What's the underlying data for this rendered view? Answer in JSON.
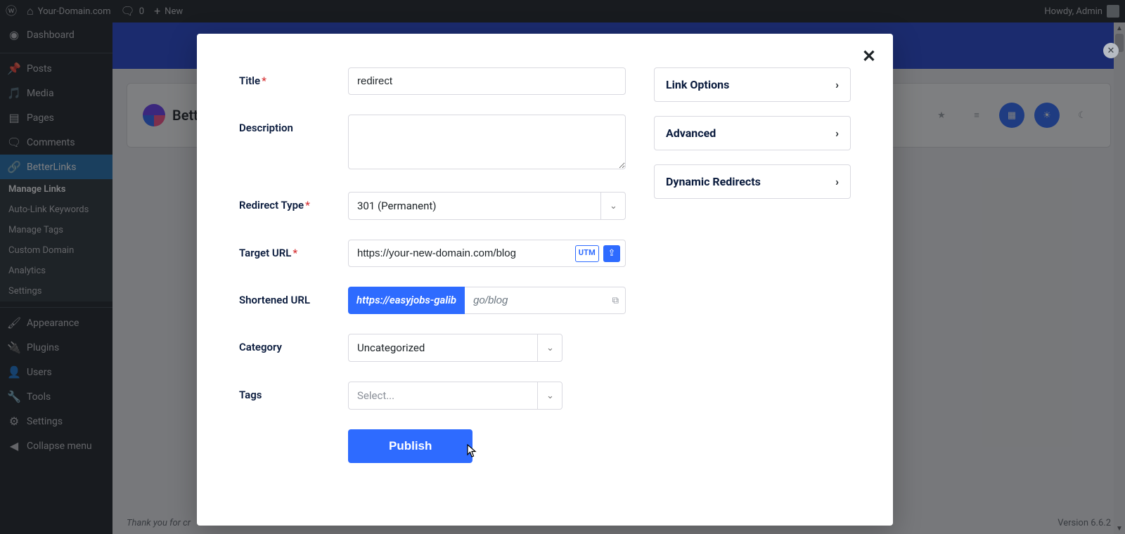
{
  "adminbar": {
    "site_name": "Your-Domain.com",
    "comments_count": "0",
    "new_label": "New",
    "greeting": "Howdy, Admin"
  },
  "sidebar": {
    "dashboard": "Dashboard",
    "posts": "Posts",
    "media": "Media",
    "pages": "Pages",
    "comments": "Comments",
    "betterlinks": "BetterLinks",
    "submenu": {
      "manage_links": "Manage Links",
      "auto_link": "Auto-Link Keywords",
      "manage_tags": "Manage Tags",
      "custom_domain": "Custom Domain",
      "analytics": "Analytics",
      "settings": "Settings"
    },
    "appearance": "Appearance",
    "plugins": "Plugins",
    "users": "Users",
    "tools": "Tools",
    "settings": "Settings",
    "collapse": "Collapse menu"
  },
  "page": {
    "brand": "Bett",
    "footer_thank": "Thank you for cr",
    "version": "Version 6.6.2"
  },
  "modal": {
    "labels": {
      "title": "Title",
      "description": "Description",
      "redirect_type": "Redirect Type",
      "target_url": "Target URL",
      "shortened_url": "Shortened URL",
      "category": "Category",
      "tags": "Tags"
    },
    "values": {
      "title": "redirect",
      "description": "",
      "redirect_type": "301 (Permanent)",
      "target_url": "https://your-new-domain.com/blog",
      "short_base": "https://easyjobs-galib",
      "short_slug": "go/blog",
      "category": "Uncategorized",
      "tags_placeholder": "Select..."
    },
    "utm_label": "UTM",
    "publish": "Publish",
    "panels": {
      "link_options": "Link Options",
      "advanced": "Advanced",
      "dynamic_redirects": "Dynamic Redirects"
    }
  }
}
